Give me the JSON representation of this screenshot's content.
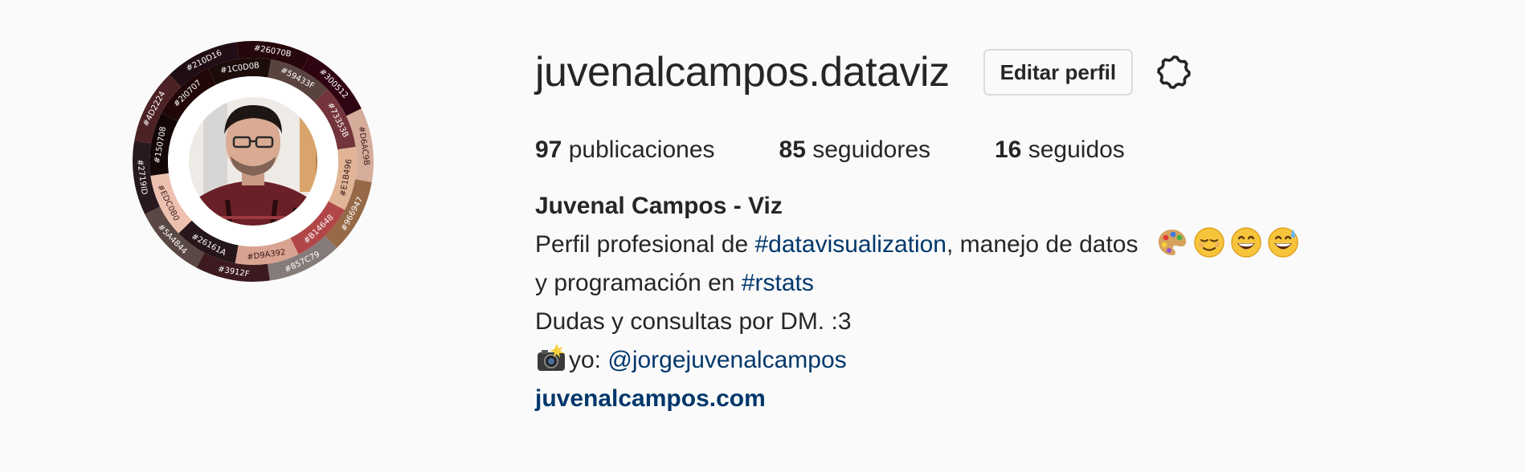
{
  "profile": {
    "username": "juvenalcampos.dataviz",
    "edit_button": "Editar perfil",
    "settings_icon": "gear-icon",
    "avatar": {
      "icon": "profile-photo",
      "ring_labels": [
        "#26070B",
        "#59433F",
        "#300512",
        "#73353B",
        "#D6AC9B",
        "#E1B496",
        "#966947",
        "#B14648",
        "#857C79",
        "#D9A392",
        "#3912F",
        "#26161A",
        "#5A4844",
        "#EDC0B0",
        "#2719ID",
        "#150708",
        "#4D2224",
        "#2I0707",
        "#210D16",
        "#1C0D0B"
      ],
      "ring_colors": [
        "#26070b",
        "#59433f",
        "#300512",
        "#73353b",
        "#d6ac9b",
        "#e1b496",
        "#966947",
        "#b14648",
        "#857c79",
        "#d9a392",
        "#3d1a1f",
        "#26161a",
        "#5a4844",
        "#edc0b0",
        "#27191d",
        "#150708",
        "#4d2224",
        "#210707",
        "#210d16",
        "#1c0d0b"
      ]
    }
  },
  "stats": [
    {
      "count": "97",
      "label": "publicaciones"
    },
    {
      "count": "85",
      "label": "seguidores"
    },
    {
      "count": "16",
      "label": "seguidos"
    }
  ],
  "bio": {
    "full_name": "Juvenal Campos - Viz",
    "line1_prefix": "Perfil profesional de ",
    "line1_tag": "#datavisualization",
    "line1_suffix": ", manejo de datos",
    "line1_emojis": [
      "artist-palette-emoji",
      "relieved-face-emoji",
      "grinning-face-emoji",
      "grinning-sweat-emoji"
    ],
    "line2_prefix": "y programación en ",
    "line2_tag": "#rstats",
    "line3": "Dudas y consultas por DM. :3",
    "line4_emoji": "camera-with-flash-emoji",
    "line4_prefix": "yo: ",
    "line4_mention": "@jorgejuvenalcampos",
    "website": "juvenalcampos.com"
  },
  "colors": {
    "link": "#00376b",
    "text": "#262626",
    "background": "#fafafa",
    "button_border": "#dbdbdb"
  }
}
